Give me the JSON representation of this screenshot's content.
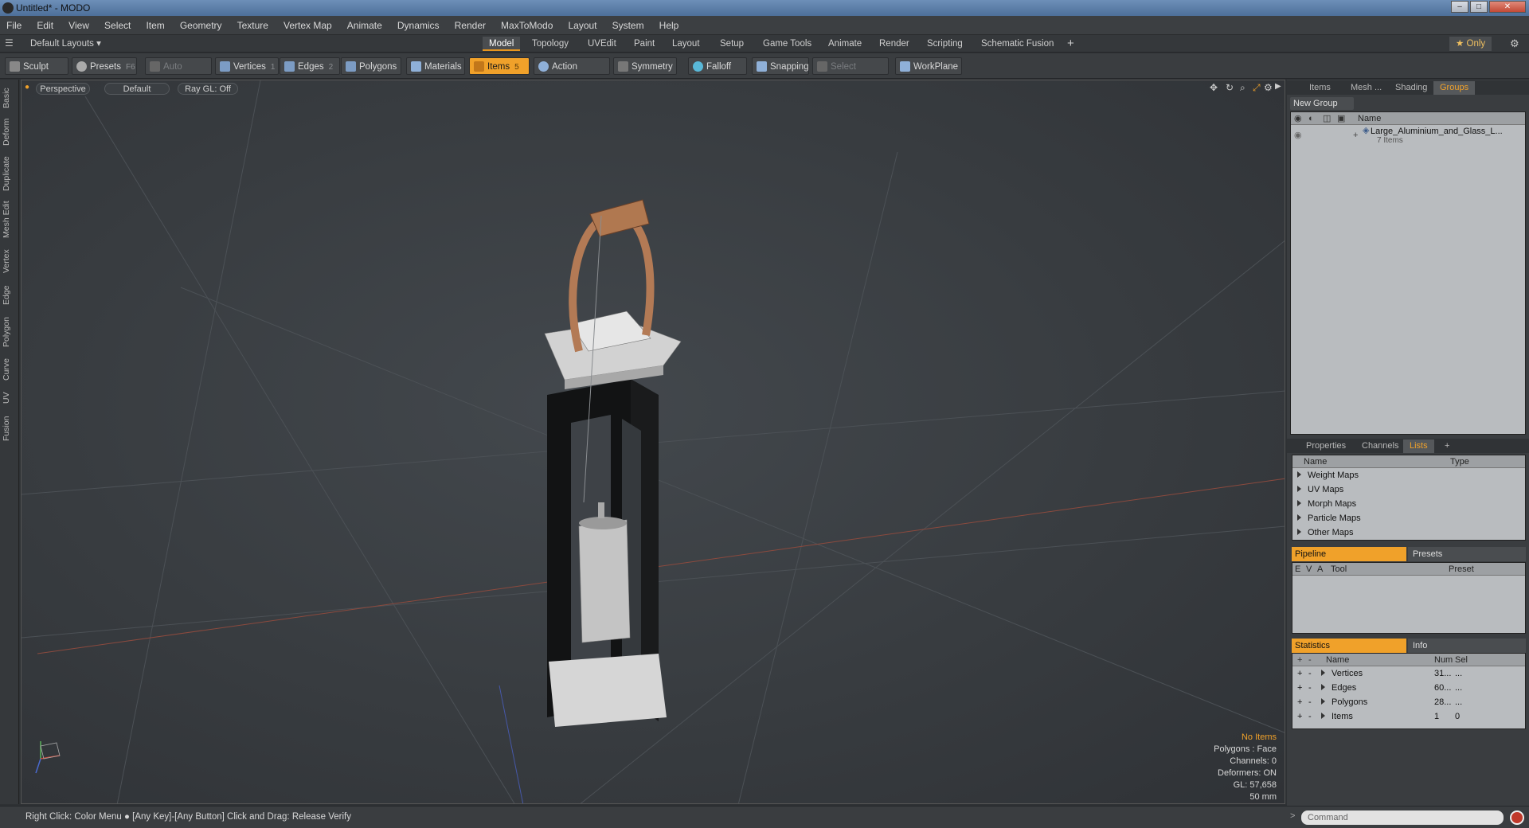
{
  "window": {
    "title": "Untitled* - MODO",
    "minimize": "–",
    "maximize": "□",
    "close": "✕"
  },
  "menu": [
    "File",
    "Edit",
    "View",
    "Select",
    "Item",
    "Geometry",
    "Texture",
    "Vertex Map",
    "Animate",
    "Dynamics",
    "Render",
    "MaxToModo",
    "Layout",
    "System",
    "Help"
  ],
  "layout_bar": {
    "layouts_label": "Default Layouts ▾",
    "tabs": [
      "Model",
      "Topology",
      "UVEdit",
      "Paint",
      "Layout",
      "Setup",
      "Game Tools",
      "Animate",
      "Render",
      "Scripting",
      "Schematic Fusion"
    ],
    "active_tab": "Model",
    "add_tab": "+",
    "only_label": "★ Only"
  },
  "toolbar": {
    "sculpt": "Sculpt",
    "presets": "Presets",
    "presets_key": "F6",
    "auto_select": "Auto Select",
    "vertices": "Vertices",
    "vertices_key": "1",
    "edges": "Edges",
    "edges_key": "2",
    "polygons": "Polygons",
    "materials": "Materials",
    "items": "Items",
    "items_key": "5",
    "action_center": "Action Center",
    "symmetry": "Symmetry",
    "falloff": "Falloff",
    "snapping": "Snapping",
    "select_through": "Select Through",
    "workplane": "WorkPlane"
  },
  "side_tabs": [
    "Basic",
    "Deform",
    "Duplicate",
    "Mesh Edit",
    "Vertex",
    "Edge",
    "Polygon",
    "Curve",
    "UV",
    "Fusion"
  ],
  "viewport": {
    "view": "Perspective",
    "shading": "Default",
    "raygl": "Ray GL: Off",
    "hud": {
      "selection": "No Items",
      "polygons": "Polygons : Face",
      "channels": "Channels: 0",
      "deformers": "Deformers: ON",
      "gl": "GL: 57,658",
      "scale": "50 mm"
    }
  },
  "groups_panel": {
    "tabs": [
      "Items",
      "Mesh ...",
      "Shading",
      "Groups"
    ],
    "active_tab": "Groups",
    "new_group": "New Group",
    "name_header": "Name",
    "group_name": "Large_Aluminium_and_Glass_L...",
    "group_count": "7 Items"
  },
  "lists_panel": {
    "tabs": [
      "Properties",
      "Channels",
      "Lists"
    ],
    "active_tab": "Lists",
    "add": "+",
    "col_name": "Name",
    "col_type": "Type",
    "items": [
      "Weight Maps",
      "UV Maps",
      "Morph Maps",
      "Particle Maps",
      "Other Maps"
    ]
  },
  "pipeline_panel": {
    "tab_active": "Pipeline",
    "tab_other": "Presets",
    "cols": [
      "E",
      "V",
      "A",
      "Tool",
      "Preset"
    ]
  },
  "statistics_panel": {
    "tab_active": "Statistics",
    "tab_other": "Info",
    "col_name": "Name",
    "col_num": "Num",
    "col_sel": "Sel",
    "rows": [
      {
        "name": "Vertices",
        "num": "31...",
        "sel": "..."
      },
      {
        "name": "Edges",
        "num": "60...",
        "sel": "..."
      },
      {
        "name": "Polygons",
        "num": "28...",
        "sel": "..."
      },
      {
        "name": "Items",
        "num": "1",
        "sel": "0"
      }
    ]
  },
  "status": {
    "hint": "Right Click: Color Menu ● [Any Key]-[Any Button] Click and Drag: Release Verify",
    "command_placeholder": "Command"
  }
}
